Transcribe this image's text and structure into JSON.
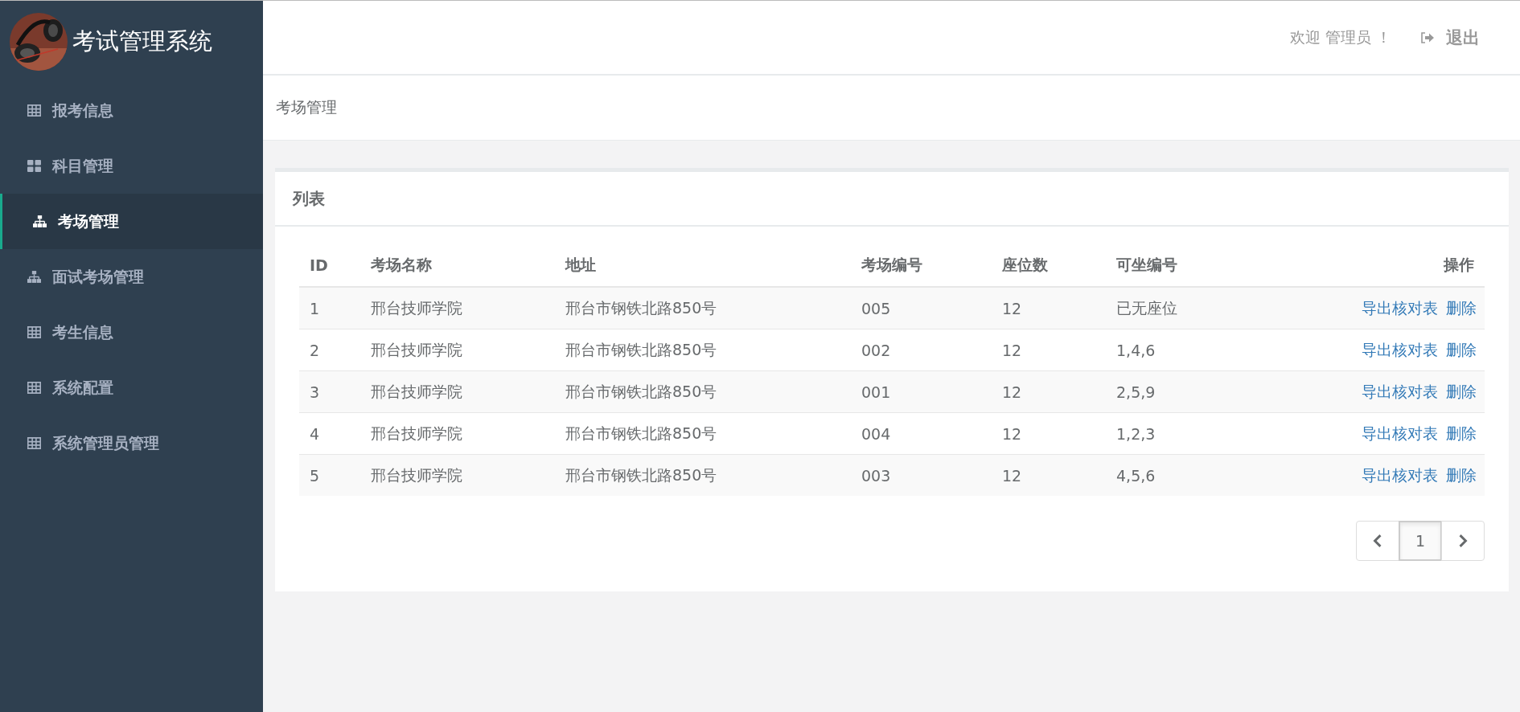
{
  "sidebar": {
    "title": "考试管理系统",
    "items": [
      {
        "label": "报考信息",
        "kind": "grid",
        "selected": false
      },
      {
        "label": "科目管理",
        "kind": "tiles",
        "selected": false
      },
      {
        "label": "考场管理",
        "kind": "tree",
        "selected": true
      },
      {
        "label": "面试考场管理",
        "kind": "tree",
        "selected": false
      },
      {
        "label": "考生信息",
        "kind": "grid",
        "selected": false
      },
      {
        "label": "系统配置",
        "kind": "grid",
        "selected": false
      },
      {
        "label": "系统管理员管理",
        "kind": "grid",
        "selected": false
      }
    ]
  },
  "header": {
    "welcome": "欢迎 管理员 ！",
    "logout": "退出"
  },
  "breadcrumb": "考场管理",
  "card": {
    "title": "列表",
    "table": {
      "columns": [
        "ID",
        "考场名称",
        "地址",
        "考场编号",
        "座位数",
        "可坐编号",
        "操作"
      ],
      "rows": [
        {
          "cells": [
            "1",
            "邢台技师学院",
            "邢台市钢铁北路850号",
            "005",
            "12",
            "已无座位"
          ],
          "actions": [
            "导出核对表",
            "删除"
          ]
        },
        {
          "cells": [
            "2",
            "邢台技师学院",
            "邢台市钢铁北路850号",
            "002",
            "12",
            "1,4,6"
          ],
          "actions": [
            "导出核对表",
            "删除"
          ]
        },
        {
          "cells": [
            "3",
            "邢台技师学院",
            "邢台市钢铁北路850号",
            "001",
            "12",
            "2,5,9"
          ],
          "actions": [
            "导出核对表",
            "删除"
          ]
        },
        {
          "cells": [
            "4",
            "邢台技师学院",
            "邢台市钢铁北路850号",
            "004",
            "12",
            "1,2,3"
          ],
          "actions": [
            "导出核对表",
            "删除"
          ]
        },
        {
          "cells": [
            "5",
            "邢台技师学院",
            "邢台市钢铁北路850号",
            "003",
            "12",
            "4,5,6"
          ],
          "actions": [
            "导出核对表",
            "删除"
          ]
        }
      ]
    },
    "pagination": {
      "pages": [
        {
          "label": "1",
          "selected": true
        }
      ]
    }
  }
}
